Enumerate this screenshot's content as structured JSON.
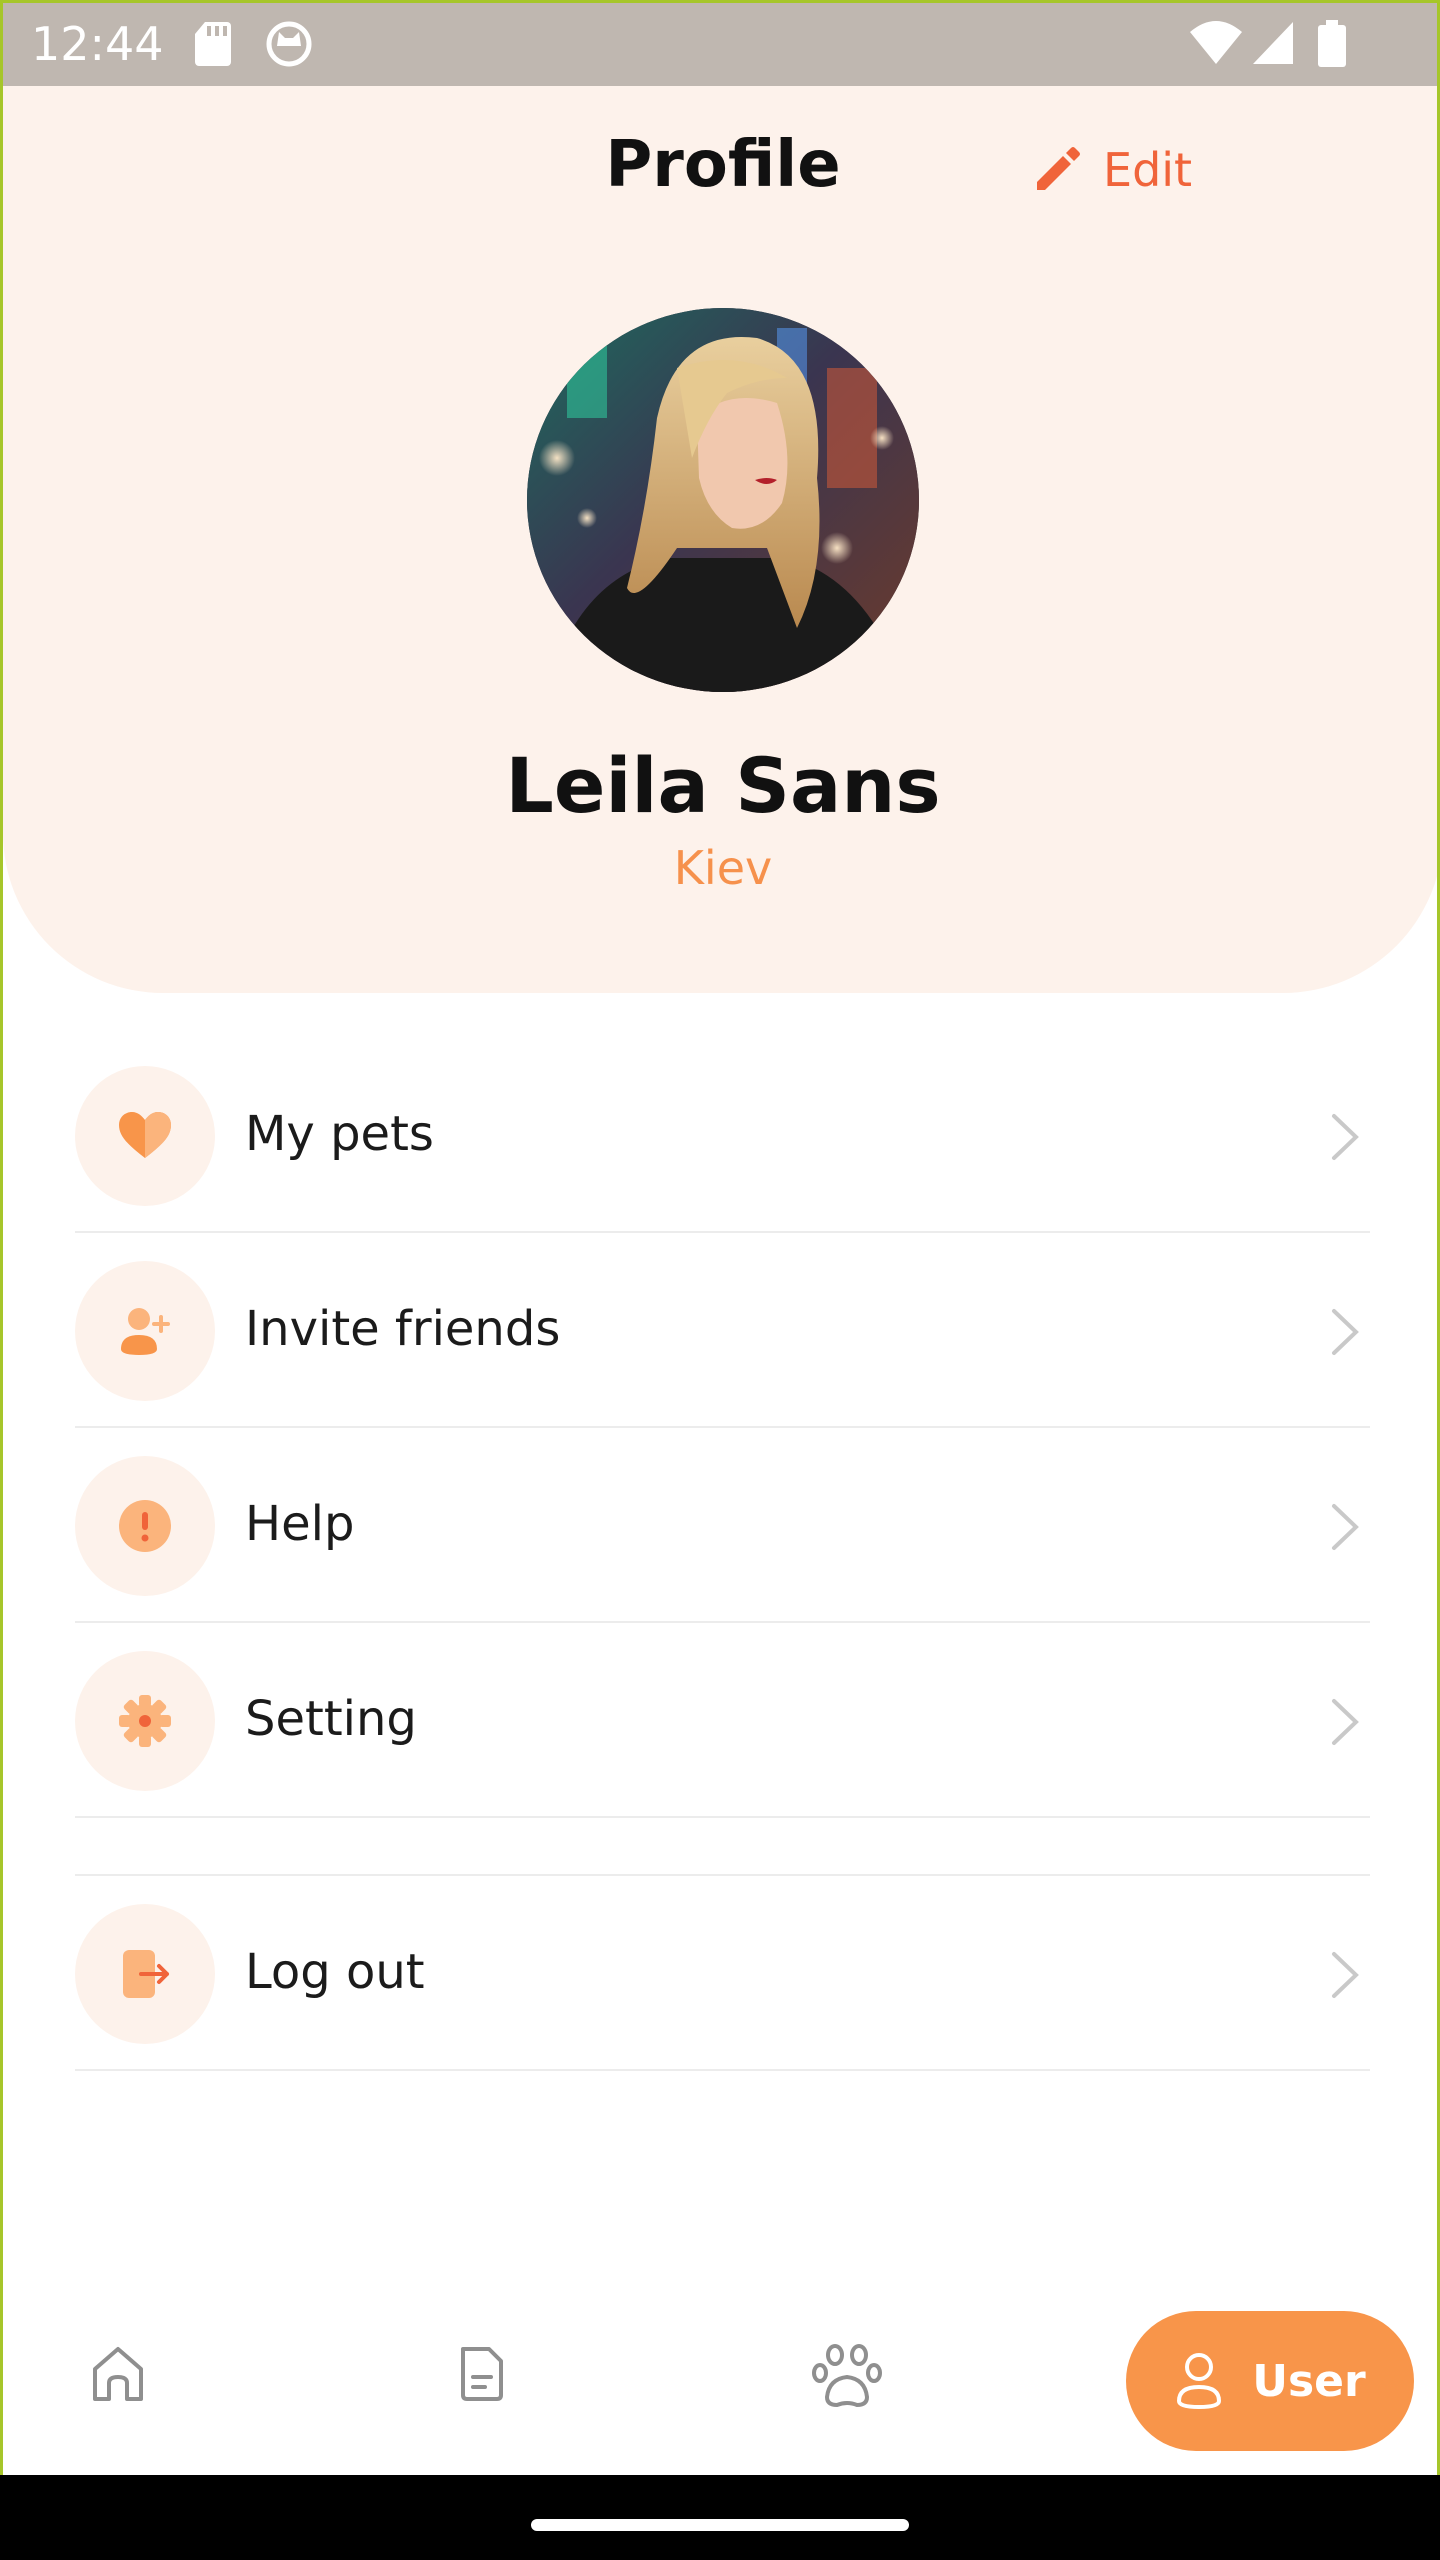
{
  "status_bar": {
    "time": "12:44"
  },
  "header": {
    "title": "Profile",
    "edit_label": "Edit",
    "user_name": "Leila Sans",
    "user_city": "Kiev"
  },
  "menu": {
    "items": [
      {
        "label": "My pets",
        "icon": "heart-icon"
      },
      {
        "label": "Invite friends",
        "icon": "add-user-icon"
      },
      {
        "label": "Help",
        "icon": "alert-icon"
      },
      {
        "label": "Setting",
        "icon": "gear-icon"
      },
      {
        "label": "Log out",
        "icon": "logout-icon"
      }
    ]
  },
  "bottom_nav": {
    "items": [
      {
        "icon": "home-icon"
      },
      {
        "icon": "document-icon"
      },
      {
        "icon": "paw-icon"
      }
    ],
    "active": {
      "label": "User",
      "icon": "user-icon"
    }
  },
  "colors": {
    "accent": "#f8954a",
    "edit": "#f0643a",
    "header_bg": "#fdf2eb",
    "icon_bg": "#fdf2eb",
    "icon_fg": "#f7a06a"
  }
}
